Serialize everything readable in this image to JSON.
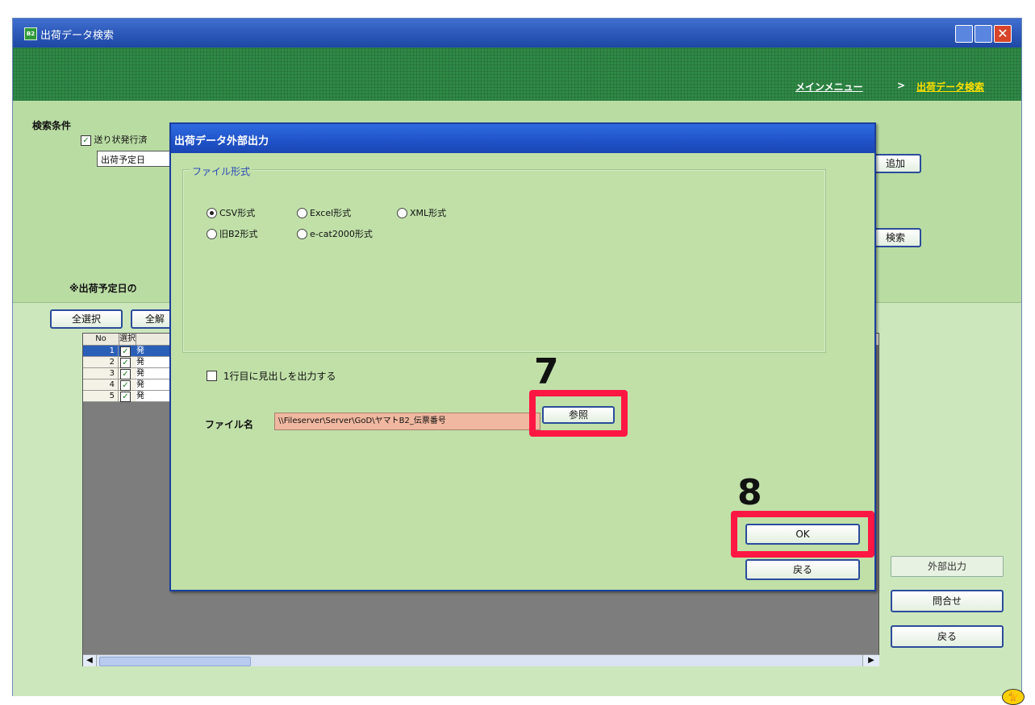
{
  "window": {
    "title": "出荷データ検索",
    "app_icon_text": "B2",
    "close_glyph": "✕"
  },
  "breadcrumb": {
    "main_menu": "メインメニュー",
    "separator": ">",
    "current": "出荷データ検索"
  },
  "search": {
    "section_label": "検索条件",
    "issued_checkbox_label": "送り状発行済",
    "date_select_value": "出荷予定日",
    "add_button": "追加",
    "search_button": "検索",
    "note": "※出荷予定日の"
  },
  "list": {
    "select_all_button": "全選択",
    "deselect_all_button": "全解",
    "columns": [
      "No",
      "選択"
    ],
    "rows": [
      {
        "no": "1",
        "checked": true,
        "cell": "発"
      },
      {
        "no": "2",
        "checked": true,
        "cell": "発"
      },
      {
        "no": "3",
        "checked": true,
        "cell": "発"
      },
      {
        "no": "4",
        "checked": true,
        "cell": "発"
      },
      {
        "no": "5",
        "checked": true,
        "cell": "発"
      }
    ]
  },
  "side_buttons": {
    "export": "外部出力",
    "inquiry": "問合せ",
    "back": "戻る"
  },
  "dialog": {
    "title": "出荷データ外部出力",
    "format_group_label": "ファイル形式",
    "formats": [
      {
        "label": "CSV形式",
        "selected": true
      },
      {
        "label": "Excel形式",
        "selected": false
      },
      {
        "label": "XML形式",
        "selected": false
      },
      {
        "label": "旧B2形式",
        "selected": false
      },
      {
        "label": "e-cat2000形式",
        "selected": false
      }
    ],
    "header_checkbox_label": "1行目に見出しを出力する",
    "file_name_label": "ファイル名",
    "file_name_value": "\\\\Fileserver\\Server\\GoD\\ヤマトB2_伝票番号",
    "browse_button": "参照",
    "ok_button": "OK",
    "back_button": "戻る"
  },
  "annotations": {
    "step7": "7",
    "step8": "8",
    "highlight_color": "#ff1744"
  },
  "colors": {
    "titlebar": "#2a56b6",
    "panel_green": "#b9dca3",
    "header_green": "#2f8a46",
    "breadcrumb_current": "#ffe000"
  }
}
